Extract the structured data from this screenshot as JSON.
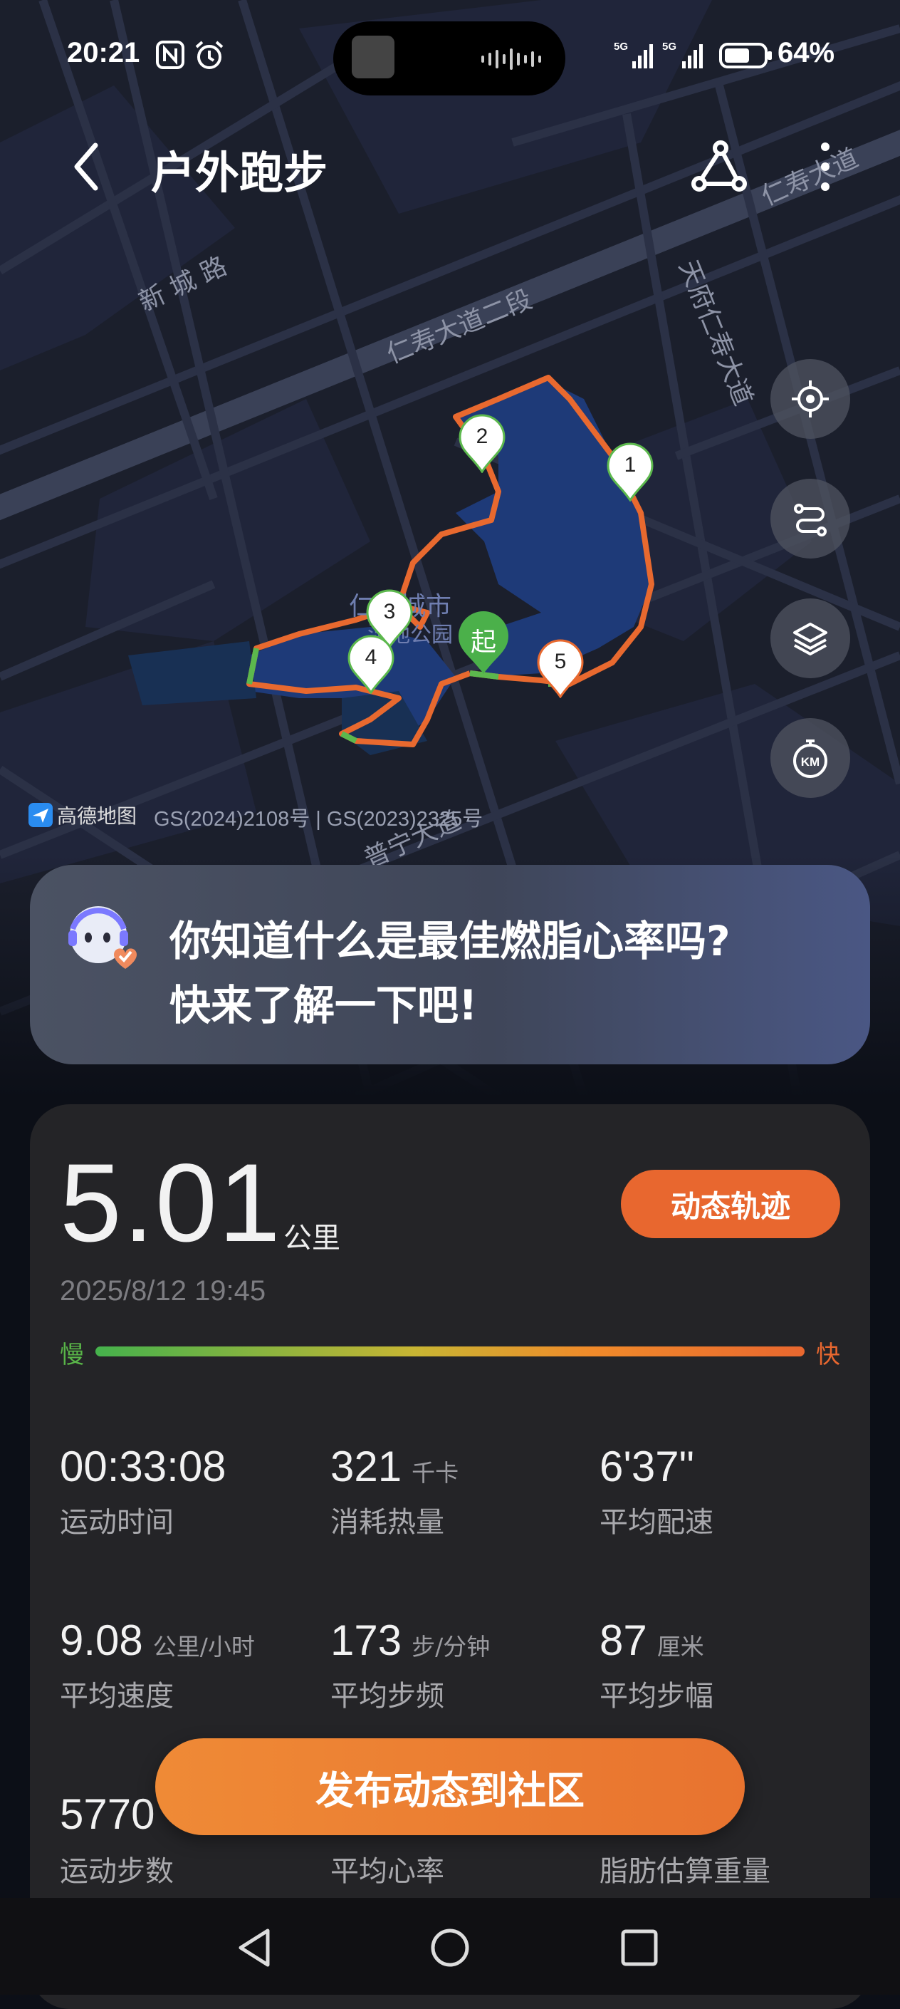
{
  "status_bar": {
    "time": "20:21",
    "network": "5G",
    "battery": "64%"
  },
  "header": {
    "title": "户外跑步"
  },
  "map": {
    "roads": [
      "新 城 路",
      "仁寿大道二段",
      "天府仁寿大道",
      "仁寿大道",
      "普宁大道"
    ],
    "park_label_1": "仁寿城市",
    "park_label_2": "湿地公园",
    "start_label": "起",
    "km_markers": [
      "1",
      "2",
      "3",
      "4",
      "5"
    ],
    "provider": "高德地图",
    "license": "GS(2024)2108号 | GS(2023)2325号",
    "km_button_label": "KM"
  },
  "banner": {
    "line1": "你知道什么是最佳燃脂心率吗?",
    "line2": "快来了解一下吧!"
  },
  "summary": {
    "distance": "5.01",
    "distance_unit": "公里",
    "dynamic_track_label": "动态轨迹",
    "datetime": "2025/8/12 19:45",
    "slow_label": "慢",
    "fast_label": "快"
  },
  "stats": [
    {
      "value": "00:33:08",
      "unit": "",
      "label": "运动时间"
    },
    {
      "value": "321",
      "unit": "千卡",
      "label": "消耗热量"
    },
    {
      "value": "6'37\"",
      "unit": "",
      "label": "平均配速"
    },
    {
      "value": "9.08",
      "unit": "公里/小时",
      "label": "平均速度"
    },
    {
      "value": "173",
      "unit": "步/分钟",
      "label": "平均步频"
    },
    {
      "value": "87",
      "unit": "厘米",
      "label": "平均步幅"
    },
    {
      "value": "5770",
      "unit": "",
      "label": "运动步数"
    },
    {
      "value": "",
      "unit": "",
      "label": "平均心率"
    },
    {
      "value": "",
      "unit": "",
      "label": "脂肪估算重量"
    }
  ],
  "publish_label": "发布动态到社区",
  "colors": {
    "accent": "#e8672f",
    "route": "#e8692f",
    "route_green": "#5cb84d",
    "card_bg": "#242427"
  }
}
